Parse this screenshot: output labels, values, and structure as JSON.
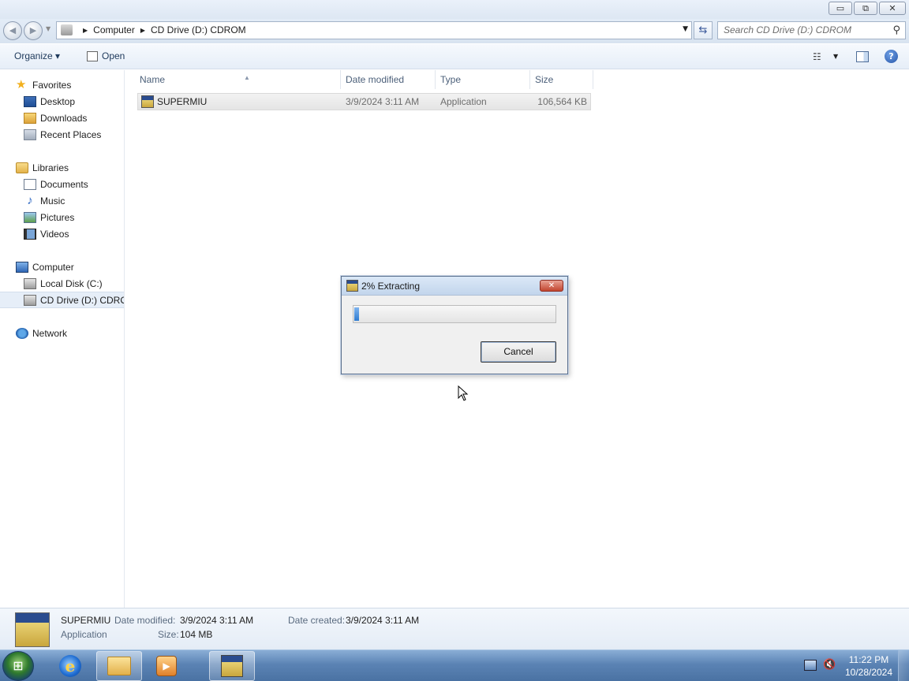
{
  "window": {
    "minimize_glyph": "▭",
    "maximize_glyph": "⧉",
    "close_glyph": "✕"
  },
  "address": {
    "crumbs": [
      "Computer",
      "CD Drive (D:) CDROM"
    ],
    "search_placeholder": "Search CD Drive (D:) CDROM"
  },
  "toolbar": {
    "organize_label": "Organize ▾",
    "open_label": "Open"
  },
  "nav": {
    "favorites": "Favorites",
    "desktop": "Desktop",
    "downloads": "Downloads",
    "recent_places": "Recent Places",
    "libraries": "Libraries",
    "documents": "Documents",
    "music": "Music",
    "pictures": "Pictures",
    "videos": "Videos",
    "computer": "Computer",
    "local_disk": "Local Disk (C:)",
    "cd_drive": "CD Drive (D:) CDROM",
    "network": "Network"
  },
  "columns": {
    "name": "Name",
    "date_modified": "Date modified",
    "type": "Type",
    "size": "Size"
  },
  "files": [
    {
      "name": "SUPERMIU",
      "date_modified": "3/9/2024 3:11 AM",
      "type": "Application",
      "size": "106,564 KB"
    }
  ],
  "dialog": {
    "title": "2% Extracting",
    "progress_fraction": 0.02,
    "cancel_label": "Cancel",
    "close_glyph": "✕"
  },
  "details": {
    "name": "SUPERMIU",
    "kind": "Application",
    "date_modified_label": "Date modified:",
    "date_modified": "3/9/2024 3:11 AM",
    "date_created_label": "Date created:",
    "date_created": "3/9/2024 3:11 AM",
    "size_label": "Size:",
    "size": "104 MB"
  },
  "taskbar": {
    "time": "11:22 PM",
    "date": "10/28/2024"
  }
}
